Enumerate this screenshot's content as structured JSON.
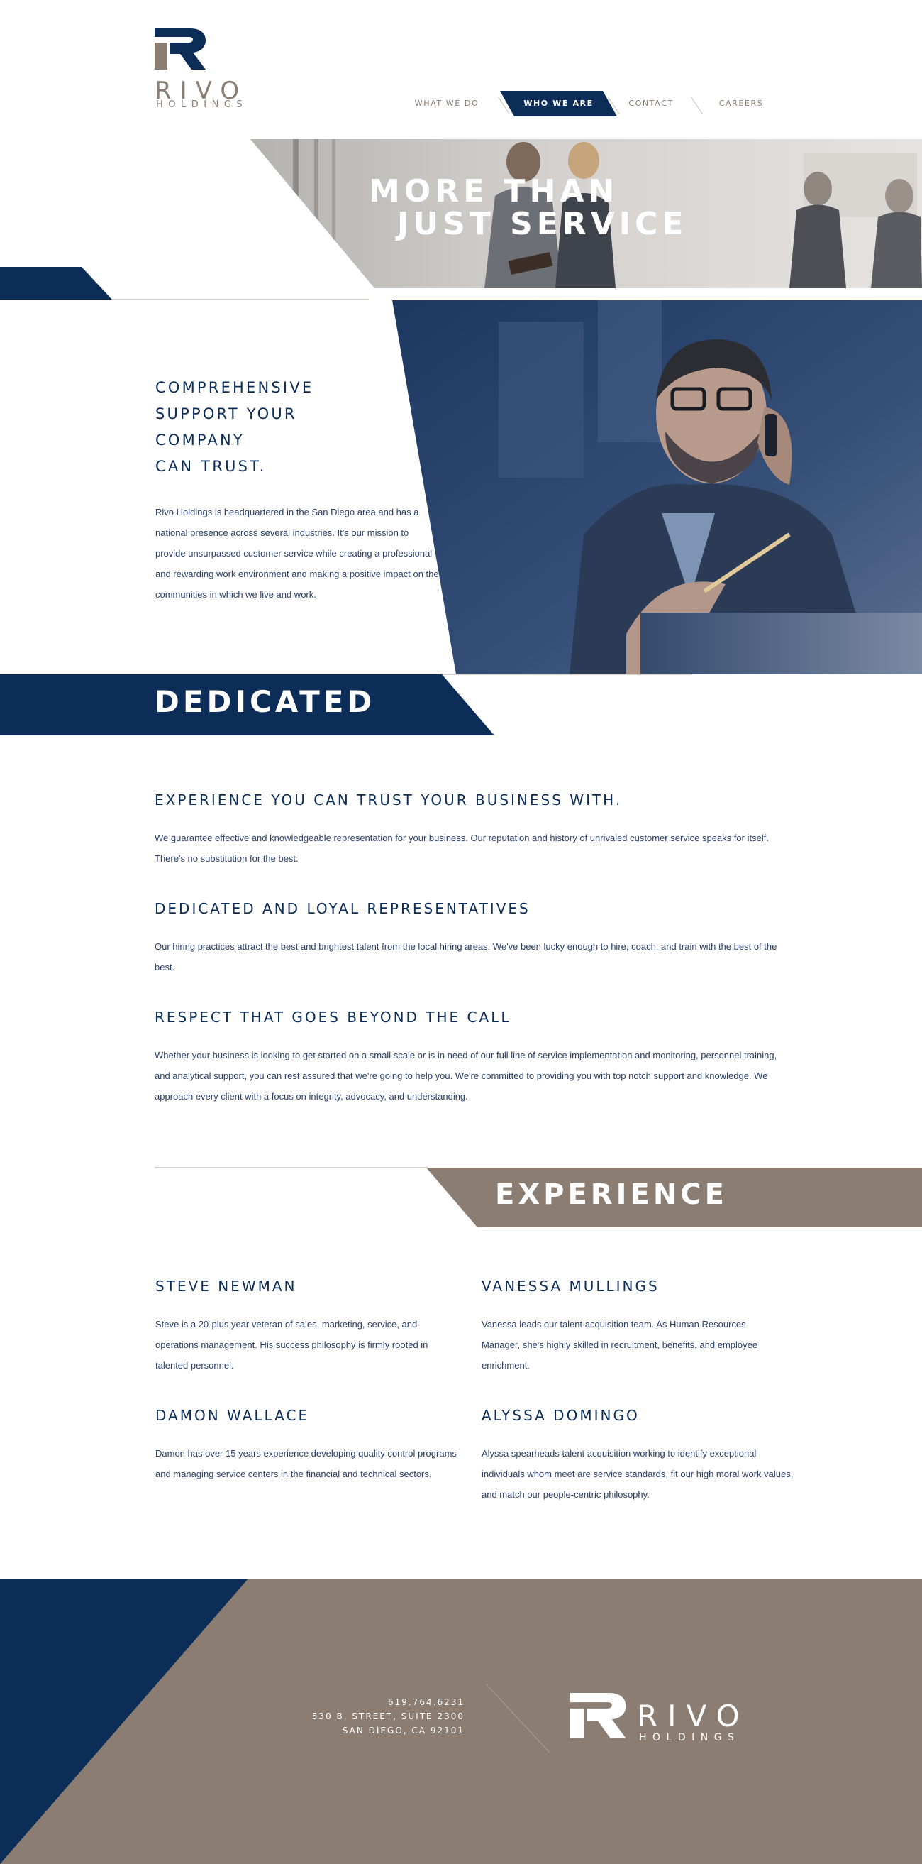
{
  "brand": {
    "name": "RIVO",
    "sub": "HOLDINGS",
    "colors": {
      "navy": "#0c2d57",
      "taupe": "#8b7d71",
      "text": "#2a4068"
    }
  },
  "nav": {
    "items": [
      {
        "label": "WHAT WE DO"
      },
      {
        "label": "WHO WE ARE",
        "active": true
      },
      {
        "label": "CONTACT"
      },
      {
        "label": "CAREERS"
      }
    ]
  },
  "hero": {
    "line1": "MORE THAN",
    "line2": "JUST SERVICE"
  },
  "support": {
    "heading_lines": [
      "COMPREHENSIVE",
      "SUPPORT YOUR",
      "COMPANY",
      "CAN TRUST."
    ],
    "body": "Rivo Holdings is headquartered in the San Diego area and has a national presence across several industries.  It's our mission to provide unsurpassed customer service while creating a professional and rewarding work environment and making a positive impact on the communities in which we live and work."
  },
  "dedicated": {
    "banner": "DEDICATED",
    "features": [
      {
        "title": "EXPERIENCE YOU CAN TRUST YOUR BUSINESS WITH.",
        "body": "We guarantee effective and knowledgeable representation for your business. Our reputation and history of unrivaled customer service speaks for itself. There's no substitution for the best."
      },
      {
        "title": "DEDICATED AND LOYAL REPRESENTATIVES",
        "body": "Our hiring practices attract the best and brightest talent from the local hiring areas. We've been lucky enough to hire, coach, and train with the best of the best."
      },
      {
        "title": "RESPECT THAT GOES BEYOND THE CALL",
        "body": "Whether your business is looking to get started on a small scale or is in need of our full line of service implementation and monitoring, personnel training, and analytical support, you can rest assured that we're going to help you. We're committed to providing you with top notch support and knowledge. We approach every client with a focus on integrity, advocacy, and understanding."
      }
    ]
  },
  "experience": {
    "banner": "EXPERIENCE",
    "team": [
      {
        "name": "STEVE NEWMAN",
        "bio": "Steve is a 20-plus year veteran of sales, marketing, service, and operations management. His success philosophy is firmly rooted in talented personnel."
      },
      {
        "name": "VANESSA MULLINGS",
        "bio": "Vanessa leads our talent acquisition team.  As Human Resources Manager, she's highly skilled in recruitment, benefits, and employee enrichment."
      },
      {
        "name": "DAMON WALLACE",
        "bio": "Damon has over 15 years experience developing quality control programs and managing service centers in the financial and technical sectors."
      },
      {
        "name": "ALYSSA DOMINGO",
        "bio": "Alyssa spearheads talent acquisition working to identify exceptional individuals whom meet are service standards, fit our high moral work values, and match our people-centric philosophy."
      }
    ]
  },
  "footer": {
    "phone": "619.764.6231",
    "street": "530 B. Street, Suite 2300",
    "city": "San Diego, CA 92101"
  }
}
